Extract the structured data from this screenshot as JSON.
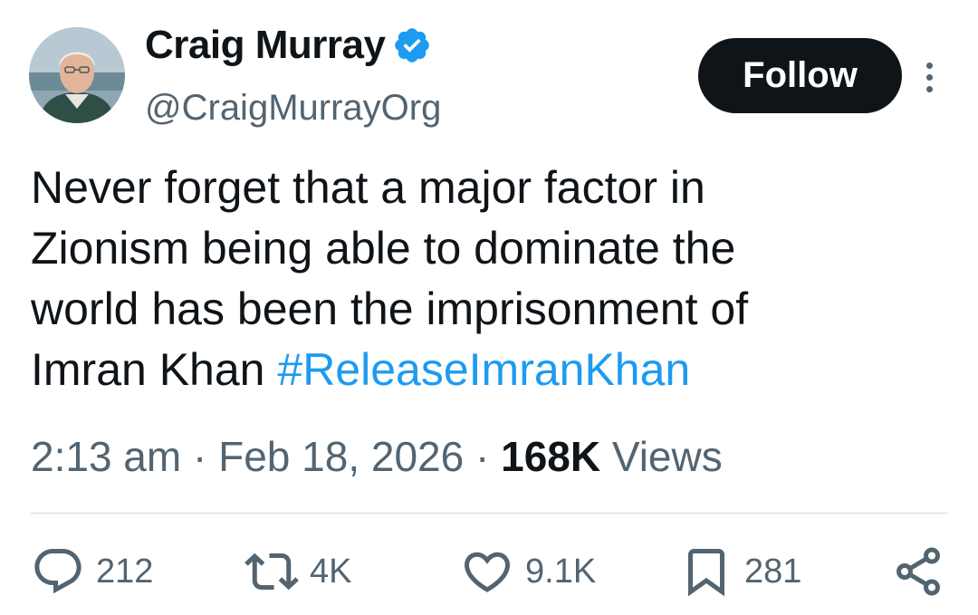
{
  "author": {
    "display_name": "Craig Murray",
    "handle": "@CraigMurrayOrg",
    "verified": true,
    "verified_color": "#1d9bf0"
  },
  "follow_button": {
    "label": "Follow"
  },
  "tweet": {
    "text_lines": [
      "Never forget that a major factor in",
      "Zionism being able to dominate the",
      "world has been the imprisonment of",
      "Imran Khan"
    ],
    "hashtag": "#ReleaseImranKhan",
    "hashtag_color": "#1d9bf0"
  },
  "meta": {
    "time": "2:13 am",
    "separator": " · ",
    "date": "Feb 18, 2026",
    "views_count": "168K",
    "views_label": "Views"
  },
  "actions": {
    "replies": {
      "icon": "reply-icon",
      "count": "212"
    },
    "reposts": {
      "icon": "repost-icon",
      "count": "4K"
    },
    "likes": {
      "icon": "heart-icon",
      "count": "9.1K"
    },
    "bookmarks": {
      "icon": "bookmark-icon",
      "count": "281"
    },
    "share": {
      "icon": "share-icon"
    }
  },
  "colors": {
    "text_primary": "#0f1419",
    "text_secondary": "#536471",
    "accent": "#1d9bf0",
    "divider": "#cfd9de"
  }
}
